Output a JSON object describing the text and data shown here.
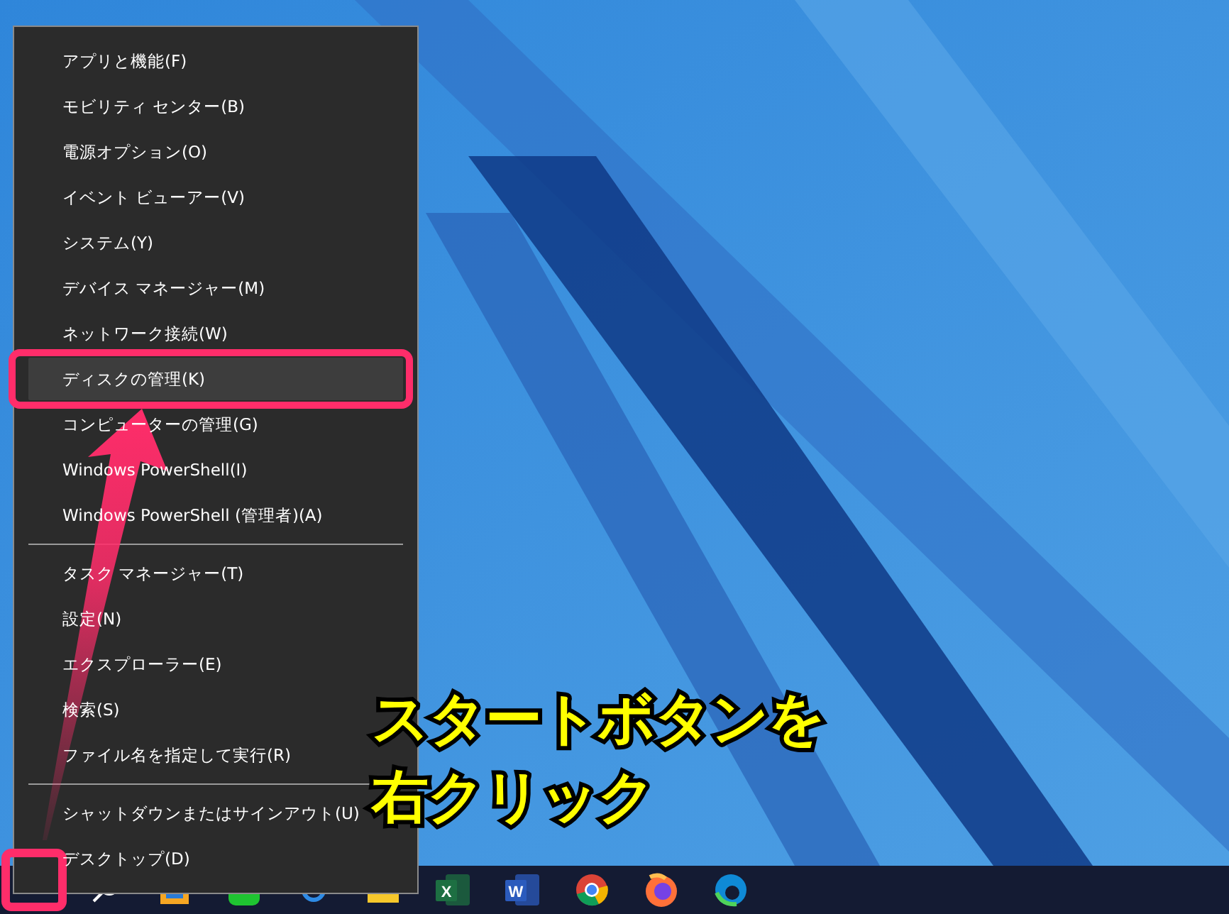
{
  "context_menu": {
    "items": [
      {
        "kind": "item",
        "label": "アプリと機能(F)",
        "selected": false
      },
      {
        "kind": "item",
        "label": "モビリティ センター(B)",
        "selected": false
      },
      {
        "kind": "item",
        "label": "電源オプション(O)",
        "selected": false
      },
      {
        "kind": "item",
        "label": "イベント ビューアー(V)",
        "selected": false
      },
      {
        "kind": "item",
        "label": "システム(Y)",
        "selected": false
      },
      {
        "kind": "item",
        "label": "デバイス マネージャー(M)",
        "selected": false
      },
      {
        "kind": "item",
        "label": "ネットワーク接続(W)",
        "selected": false
      },
      {
        "kind": "item",
        "label": "ディスクの管理(K)",
        "selected": true
      },
      {
        "kind": "item",
        "label": "コンピューターの管理(G)",
        "selected": false
      },
      {
        "kind": "item",
        "label": "Windows PowerShell(I)",
        "selected": false
      },
      {
        "kind": "item",
        "label": "Windows PowerShell (管理者)(A)",
        "selected": false
      },
      {
        "kind": "separator"
      },
      {
        "kind": "item",
        "label": "タスク マネージャー(T)",
        "selected": false
      },
      {
        "kind": "item",
        "label": "設定(N)",
        "selected": false
      },
      {
        "kind": "item",
        "label": "エクスプローラー(E)",
        "selected": false
      },
      {
        "kind": "item",
        "label": "検索(S)",
        "selected": false
      },
      {
        "kind": "item",
        "label": "ファイル名を指定して実行(R)",
        "selected": false
      },
      {
        "kind": "separator"
      },
      {
        "kind": "item",
        "label": "シャットダウンまたはサインアウト(U)",
        "selected": false
      },
      {
        "kind": "item",
        "label": "デスクトップ(D)",
        "selected": false
      }
    ]
  },
  "taskbar": {
    "apps": [
      {
        "kind": "search"
      },
      {
        "kind": "store"
      },
      {
        "kind": "line"
      },
      {
        "kind": "settings"
      },
      {
        "kind": "folder"
      },
      {
        "kind": "excel",
        "glyph": "X"
      },
      {
        "kind": "word",
        "glyph": "W"
      },
      {
        "kind": "chrome"
      },
      {
        "kind": "firefox"
      },
      {
        "kind": "edge"
      }
    ]
  },
  "annotation": {
    "lines": [
      "スタートボタンを",
      "右クリック"
    ]
  }
}
